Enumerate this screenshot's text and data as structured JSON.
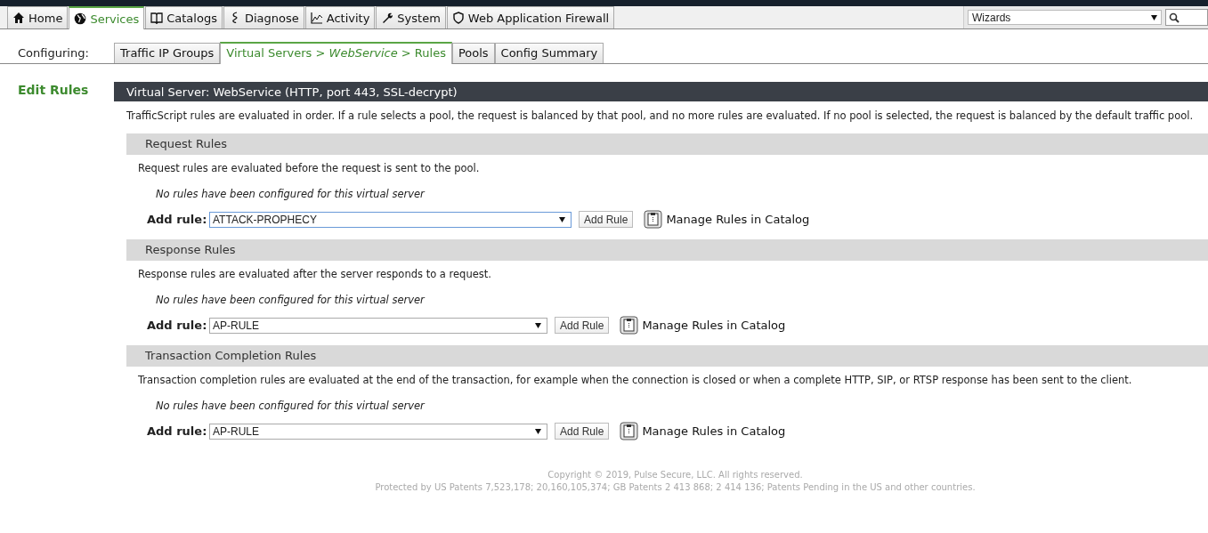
{
  "nav": {
    "tabs": [
      {
        "label": "Home",
        "selected": false
      },
      {
        "label": "Services",
        "selected": true
      },
      {
        "label": "Catalogs",
        "selected": false
      },
      {
        "label": "Diagnose",
        "selected": false
      },
      {
        "label": "Activity",
        "selected": false
      },
      {
        "label": "System",
        "selected": false
      },
      {
        "label": "Web Application Firewall",
        "selected": false
      }
    ],
    "wizards": {
      "value": "Wizards"
    }
  },
  "subnav": {
    "label": "Configuring:",
    "tabs": [
      {
        "label": "Traffic IP Groups",
        "selected": false
      },
      {
        "label": "Virtual Servers > *WebService* > Rules",
        "selected": true
      },
      {
        "label": "Pools",
        "selected": false
      },
      {
        "label": "Config Summary",
        "selected": false
      }
    ]
  },
  "sidebar": {
    "title": "Edit Rules"
  },
  "panel": {
    "title": "Virtual Server: WebService (HTTP, port 443, SSL-decrypt)",
    "description": "TrafficScript rules are evaluated in order. If a rule selects a pool, the request is balanced by that pool, and no more rules are evaluated. If no pool is selected, the request is balanced by the default traffic pool.",
    "sections": [
      {
        "title": "Request Rules",
        "description": "Request rules are evaluated before the request is sent to the pool.",
        "empty_note": "No rules have been configured for this virtual server",
        "add_label": "Add rule:",
        "dropdown": {
          "value": "ATTACK-PROPHECY",
          "focused": true
        },
        "button": "Add Rule",
        "link": "Manage Rules in Catalog"
      },
      {
        "title": "Response Rules",
        "description": "Response rules are evaluated after the server responds to a request.",
        "empty_note": "No rules have been configured for this virtual server",
        "add_label": "Add rule:",
        "dropdown": {
          "value": "AP-RULE",
          "focused": false
        },
        "button": "Add Rule",
        "link": "Manage Rules in Catalog"
      },
      {
        "title": "Transaction Completion Rules",
        "description": "Transaction completion rules are evaluated at the end of the transaction, for example when the connection is closed or when a complete HTTP, SIP, or RTSP response has been sent to the client.",
        "empty_note": "No rules have been configured for this virtual server",
        "add_label": "Add rule:",
        "dropdown": {
          "value": "AP-RULE",
          "focused": false
        },
        "button": "Add Rule",
        "link": "Manage Rules in Catalog"
      }
    ]
  },
  "footer": {
    "lines": [
      "Copyright © 2019, Pulse Secure, LLC. All rights reserved.",
      "Protected by US Patents 7,523,178; 20,160,105,374; GB Patents 2 413 868; 2 414 136; Patents Pending in the US and other countries."
    ]
  }
}
